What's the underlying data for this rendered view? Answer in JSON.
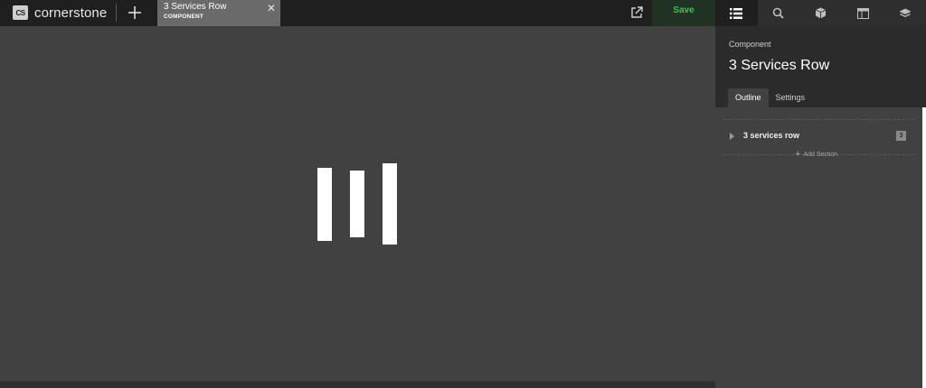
{
  "app": {
    "logo_badge": "CS",
    "logo_text": "cornerstone",
    "add_icon": "plus-icon"
  },
  "tab": {
    "title": "3 Services Row",
    "subtitle": "COMPONENT",
    "close_glyph": "✕"
  },
  "toolbar": {
    "save_label": "Save",
    "export_icon": "external-link-icon",
    "nav_icons": [
      "list-icon",
      "search-icon",
      "cube-icon",
      "layout-icon",
      "layers-icon"
    ]
  },
  "panel": {
    "label": "Component",
    "title": "3 Services Row",
    "tabs": [
      "Outline",
      "Settings"
    ],
    "outline": {
      "item_name": "3 services row",
      "item_count": "3",
      "add_section_label": "Add Section"
    }
  },
  "colors": {
    "topbar": "#1f1f1f",
    "canvas": "#414141",
    "save_text": "#3fbf5a",
    "tab_active": "#6a6a6a"
  }
}
